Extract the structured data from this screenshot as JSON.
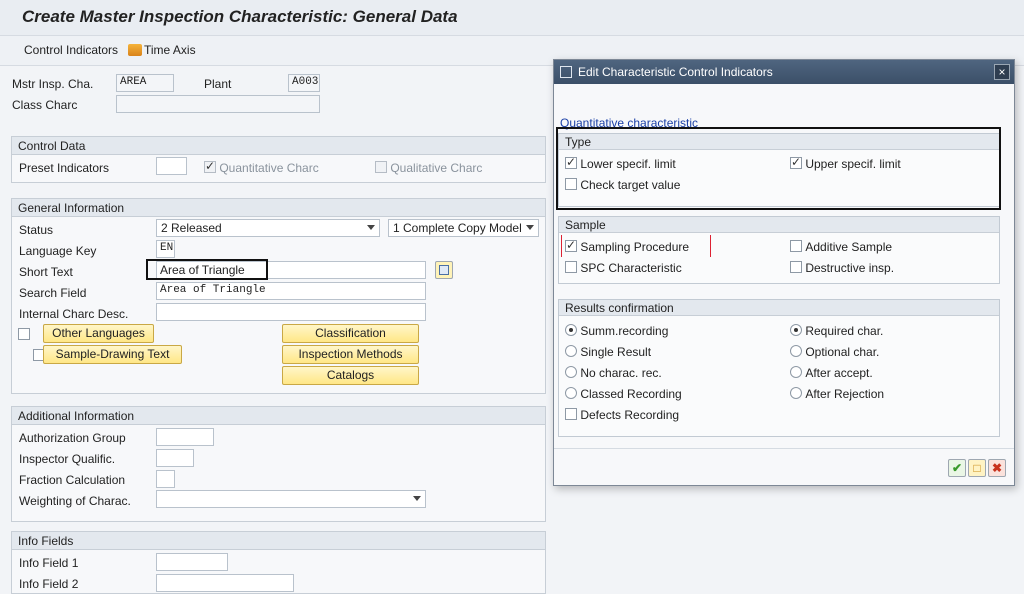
{
  "title": "Create Master Inspection Characteristic: General Data",
  "toolbar": {
    "control_indicators": "Control Indicators",
    "time_axis": "Time Axis"
  },
  "header": {
    "mstr_label": "Mstr Insp. Cha.",
    "mstr_value": "AREA",
    "plant_label": "Plant",
    "plant_value": "A003",
    "class_label": "Class Charc",
    "class_value": ""
  },
  "control_data": {
    "title": "Control Data",
    "preset_label": "Preset Indicators",
    "quantitative": "Quantitative Charc",
    "qualitative": "Qualitative Charc"
  },
  "general": {
    "title": "General Information",
    "status_label": "Status",
    "status_value": "2 Released",
    "copy_model_value": "1 Complete Copy Model",
    "lang_label": "Language Key",
    "lang_value": "EN",
    "short_label": "Short Text",
    "short_value": "Area of Triangle",
    "search_label": "Search Field",
    "search_value": "Area of Triangle",
    "internal_label": "Internal Charc Desc.",
    "btn_other_languages": "Other Languages",
    "btn_sample_drawing": "Sample-Drawing Text",
    "btn_classification": "Classification",
    "btn_inspection_methods": "Inspection Methods",
    "btn_catalogs": "Catalogs"
  },
  "additional": {
    "title": "Additional Information",
    "auth_label": "Authorization Group",
    "inspector_label": "Inspector Qualific.",
    "fraction_label": "Fraction Calculation",
    "weighting_label": "Weighting of Charac."
  },
  "info": {
    "title": "Info Fields",
    "field1": "Info Field 1",
    "field2": "Info Field 2"
  },
  "dialog": {
    "title": "Edit Characteristic Control Indicators",
    "close": "×",
    "subtitle": "Quantitative characteristic",
    "type_title": "Type",
    "lower": "Lower specif. limit",
    "upper": "Upper specif. limit",
    "check_target": "Check target value",
    "sample_title": "Sample",
    "sampling": "Sampling Procedure",
    "additive": "Additive Sample",
    "spc": "SPC Characteristic",
    "destructive": "Destructive insp.",
    "results_title": "Results confirmation",
    "summ": "Summ.recording",
    "required": "Required char.",
    "single": "Single Result",
    "optional": "Optional char.",
    "no_charac": "No charac. rec.",
    "after_accept": "After accept.",
    "classed": "Classed Recording",
    "after_reject": "After Rejection",
    "defects": "Defects Recording"
  },
  "colors": {
    "accent_link": "#1a3fa6",
    "button_yellow": "#ffe787",
    "dialog_header": "#3b4f68",
    "confirm_green": "#3a9a2b",
    "cancel_red": "#c8321e"
  }
}
